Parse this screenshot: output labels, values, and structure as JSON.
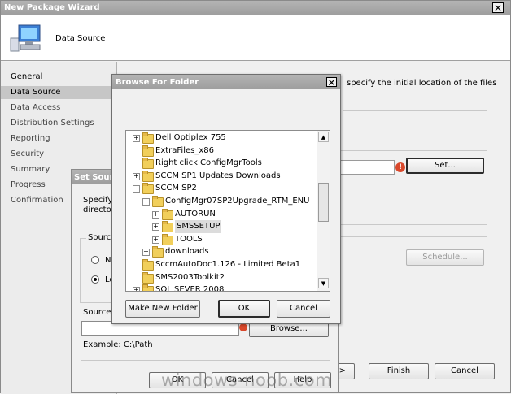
{
  "wizard": {
    "title": "New Package Wizard",
    "header_title": "Data Source",
    "instruction_fragment": "specify the initial location of the files",
    "nav": [
      "General",
      "Data Source",
      "Data Access",
      "Distribution Settings",
      "Reporting",
      "Security",
      "Summary",
      "Progress",
      "Confirmation"
    ],
    "set_button": "Set...",
    "schedule_button": "Schedule...",
    "finish_button": "Finish",
    "cancel_button": "Cancel",
    "next_fragment": ">"
  },
  "source_dialog": {
    "title_fragment": "Set Sourc",
    "desc_line1": "Specify t",
    "desc_line2": "directory",
    "group_label": "Source",
    "radio1": "N",
    "radio2": "Lo",
    "source_label": "Source d",
    "browse_button": "Browse...",
    "example": "Example: C:\\Path",
    "ok_button": "OK",
    "cancel_button": "Cancel",
    "help_button": "Help"
  },
  "browse_dialog": {
    "title": "Browse For Folder",
    "tree": [
      {
        "label": "Dell Optiplex 755",
        "depth": 0,
        "expander": "+"
      },
      {
        "label": "ExtraFiles_x86",
        "depth": 0,
        "expander": ""
      },
      {
        "label": "Right click ConfigMgrTools",
        "depth": 0,
        "expander": ""
      },
      {
        "label": "SCCM SP1 Updates Downloads",
        "depth": 0,
        "expander": "+"
      },
      {
        "label": "SCCM SP2",
        "depth": 0,
        "expander": "−"
      },
      {
        "label": "ConfigMgr07SP2Upgrade_RTM_ENU",
        "depth": 1,
        "expander": "−"
      },
      {
        "label": "AUTORUN",
        "depth": 2,
        "expander": "+"
      },
      {
        "label": "SMSSETUP",
        "depth": 2,
        "expander": "+",
        "selected": true
      },
      {
        "label": "TOOLS",
        "depth": 2,
        "expander": "+"
      },
      {
        "label": "downloads",
        "depth": 1,
        "expander": "+"
      },
      {
        "label": "SccmAutoDoc1.126 - Limited Beta1",
        "depth": 0,
        "expander": ""
      },
      {
        "label": "SMS2003Toolkit2",
        "depth": 0,
        "expander": ""
      },
      {
        "label": "SQL SEVER 2008",
        "depth": 0,
        "expander": "+"
      }
    ],
    "make_new_folder": "Make New Folder",
    "ok_button": "OK",
    "cancel_button": "Cancel"
  },
  "watermark": "windows-noob.com"
}
